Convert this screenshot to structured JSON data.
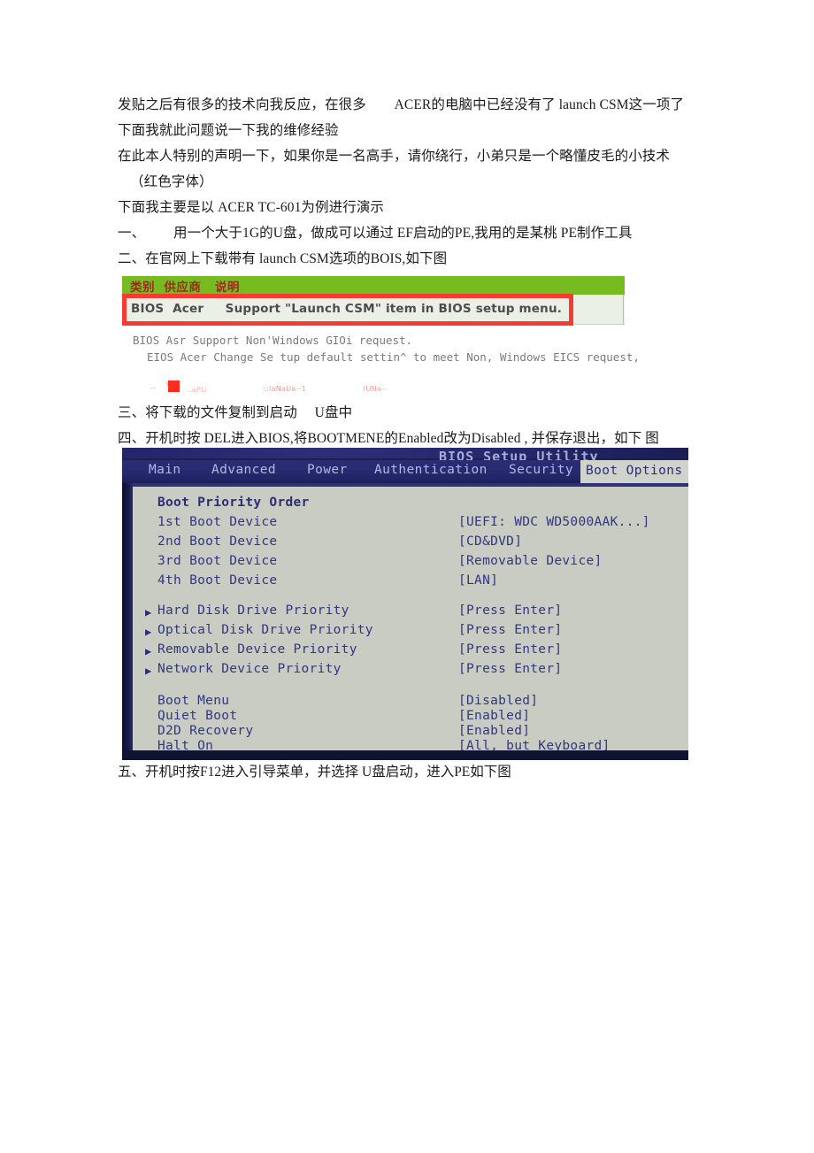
{
  "document": {
    "paragraphs": [
      {
        "id": "p1",
        "text": "发贴之后有很多的技术向我反应，在很多        ACER的电脑中已经没有了 launch CSM这一项了"
      },
      {
        "id": "p2",
        "text": "下面我就此问题说一下我的维修经验"
      },
      {
        "id": "p3",
        "text": "在此本人特别的声明一下，如果你是一名高手，请你绕行，小弟只是一个略懂皮毛的小技术"
      },
      {
        "id": "p4",
        "text": "（红色字体）",
        "indent": true
      },
      {
        "id": "p5",
        "text": "下面我主要是以 ACER TC-601为例进行演示"
      },
      {
        "id": "p6",
        "text": "一、        用一个大于1G的U盘，做成可以通过 EF启动的PE,我用的是某桃 PE制作工具"
      },
      {
        "id": "p7",
        "text": "二、在官网上下载带有 launch CSM选项的BOIS,如下图"
      },
      {
        "id": "p8",
        "text": "三、将下载的文件复制到启动     U盘中"
      },
      {
        "id": "p9",
        "text": "四、开机时按 DEL进入BIOS,将BOOTMENE的Enabled改为Disabled , 并保存退出，如下 图"
      }
    ],
    "final_caption": "五、开机时按F12进入引导菜单，并选择 U盘启动，进入PE如下图"
  },
  "bios_table_image": {
    "header_cells": "类别  供应商   说明",
    "highlighted_row": {
      "category": "BIOS",
      "vendor": "Acer",
      "description": "Support \"Launch CSM\" item in BIOS setup menu."
    },
    "row_text": "BIOS  Acer     Support \"Launch CSM\" item in BIOS setup menu.",
    "faint_rows": [
      "BIOS Asr Support Non'Windows GIOi request.",
      "EIOS Acer Change Se tup default settin^ to meet Non, Windows EICS request,"
    ],
    "colors": {
      "header_band": "#76bc21",
      "header_text": "#9b2b1c",
      "row_background": "#eaf0e6",
      "highlight_box": "#f73a32"
    }
  },
  "artifact_strip": {
    "fragments": [
      "--",
      "\\",
      "..aPLi",
      "::laNaUa--1",
      "!UNa--"
    ]
  },
  "bios_setup_image": {
    "title": "BIOS Setup Utility",
    "menu_tabs": [
      "Main",
      "Advanced",
      "Power",
      "Authentication",
      "Security"
    ],
    "active_tab": "Boot Options",
    "section_heading": "Boot Priority Order",
    "boot_devices": [
      {
        "label": "1st Boot Device",
        "value": "[UEFI: WDC WD5000AAK...]"
      },
      {
        "label": "2nd Boot Device",
        "value": "[CD&DVD]"
      },
      {
        "label": "3rd Boot Device",
        "value": "[Removable Device]"
      },
      {
        "label": "4th Boot Device",
        "value": "[LAN]"
      }
    ],
    "submenus": [
      {
        "label": "Hard Disk Drive Priority",
        "value": "[Press Enter]"
      },
      {
        "label": "Optical Disk Drive Priority",
        "value": "[Press Enter]"
      },
      {
        "label": "Removable Device Priority",
        "value": "[Press Enter]"
      },
      {
        "label": "Network Device Priority",
        "value": "[Press Enter]"
      }
    ],
    "settings": [
      {
        "label": "Boot Menu",
        "value": "[Disabled]"
      },
      {
        "label": "Quiet Boot",
        "value": "[Enabled]"
      },
      {
        "label": "D2D Recovery",
        "value": "[Enabled]"
      },
      {
        "label": "Halt On",
        "value": "[All, but Keyboard]"
      }
    ],
    "colors": {
      "screen_background": "#1d1f4e",
      "panel_background": "#c8ccc3",
      "text": "#32377e",
      "active_tab_background": "#cfd3cb"
    }
  }
}
